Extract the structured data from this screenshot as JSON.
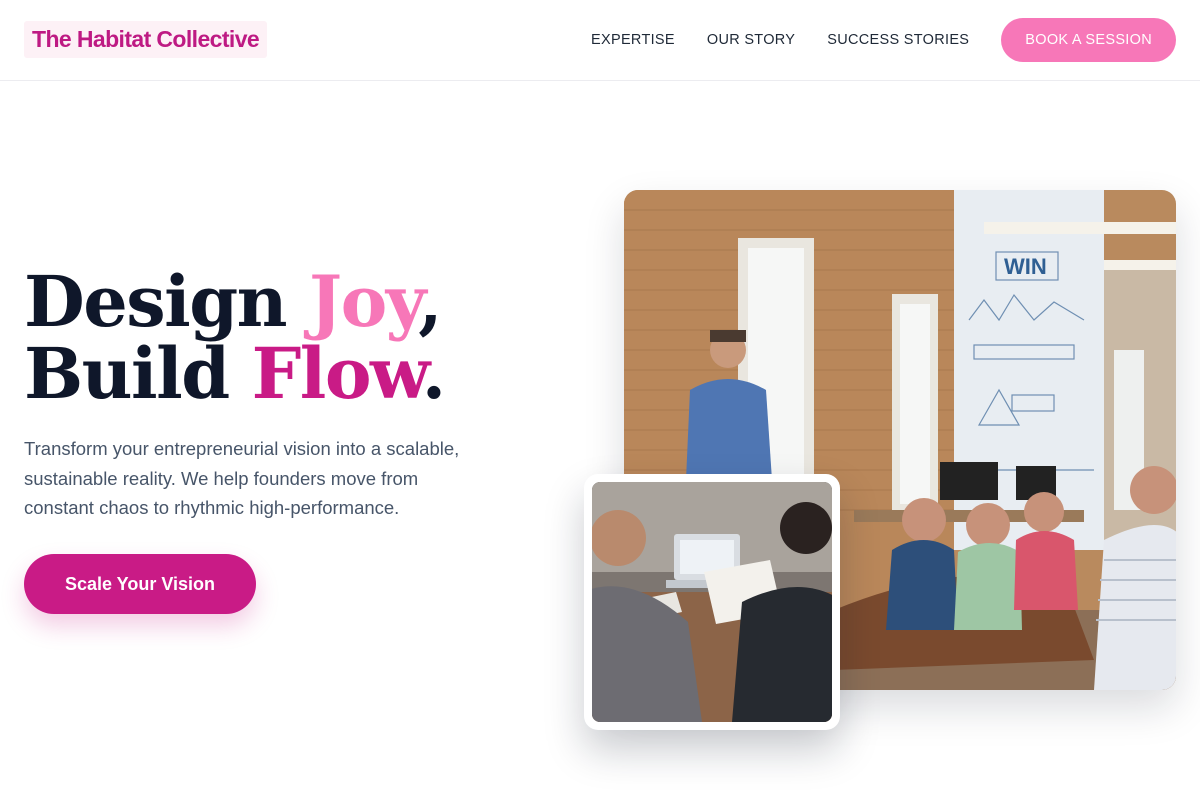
{
  "header": {
    "logo": "The Habitat Collective",
    "nav": [
      {
        "label": "EXPERTISE"
      },
      {
        "label": "OUR STORY"
      },
      {
        "label": "SUCCESS STORIES"
      }
    ],
    "cta_label": "BOOK A SESSION"
  },
  "hero": {
    "headline_line1_a": "Design ",
    "headline_line1_b": "Joy",
    "headline_line1_c": ",",
    "headline_line2_a": "Build ",
    "headline_line2_b": "Flow",
    "headline_line2_c": ".",
    "subtext": "Transform your entrepreneurial vision into a scalable, sustainable reality. We help founders move from constant chaos to rhythmic high-performance.",
    "cta_label": "Scale Your Vision"
  },
  "images": {
    "main": "office-presentation-photo",
    "inset": "business-meeting-photo"
  },
  "colors": {
    "brand_magenta": "#c91b86",
    "brand_pink": "#f777b8",
    "text_dark": "#0f172a",
    "text_muted": "#475569"
  }
}
